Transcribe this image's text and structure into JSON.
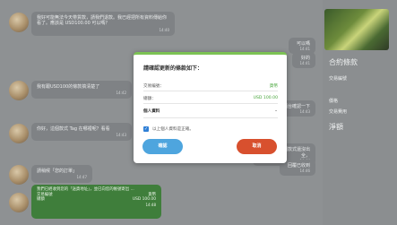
{
  "chat": {
    "messages": [
      {
        "text": "我好可能無法今天帶貨款，請我們退款。我已經把所有資料傳給你看了。應該是 USD100.00 可以嗎？",
        "time": "14:40"
      },
      {
        "text": "可以嗎",
        "time": "14:41"
      },
      {
        "text": "好的",
        "time": "14:41"
      },
      {
        "text": "我有跟USD100的條款搞清楚了",
        "time": "14:42"
      },
      {
        "text": "等等我再跟櫃台確認一下",
        "time": "14:43"
      },
      {
        "text": "你好，這個款式 Tag 在哪裡呢？看看",
        "time": "14:43"
      },
      {
        "text": "您好，這個款式還沒出全，",
        "time": "14:44"
      },
      {
        "text": "回覆已收到",
        "time": "14:46"
      },
      {
        "text": "請稍候「您的訂單」",
        "time": "14:47"
      }
    ],
    "green_card": {
      "note": "我們已經收到您的「送貨地址」，並已向您的帳號寄出 ...",
      "rows": [
        {
          "label": "交易編號",
          "value": "貨幣"
        },
        {
          "label": "總額",
          "value": "USD 100.00"
        }
      ],
      "time": "14:48"
    }
  },
  "dialog": {
    "title": "請確認更新的條款如下：",
    "rows": [
      {
        "label": "交易編號：",
        "value": "貨幣"
      },
      {
        "label": "總額：",
        "value": "USD 100.00"
      }
    ],
    "personal_info_label": "個人資料",
    "consent_label": "以上個人資料是正確。",
    "confirm_label": "確認",
    "cancel_label": "取消"
  },
  "sidebar": {
    "title": "合約條款",
    "item1": "交易編號",
    "item2": "價格",
    "item3": "交易費用",
    "total_label": "淨額"
  },
  "colors": {
    "accent_green": "#7cc254",
    "confirm_blue": "#4ea5de",
    "cancel_red": "#d8502e",
    "success_green": "#3f7e3b"
  }
}
